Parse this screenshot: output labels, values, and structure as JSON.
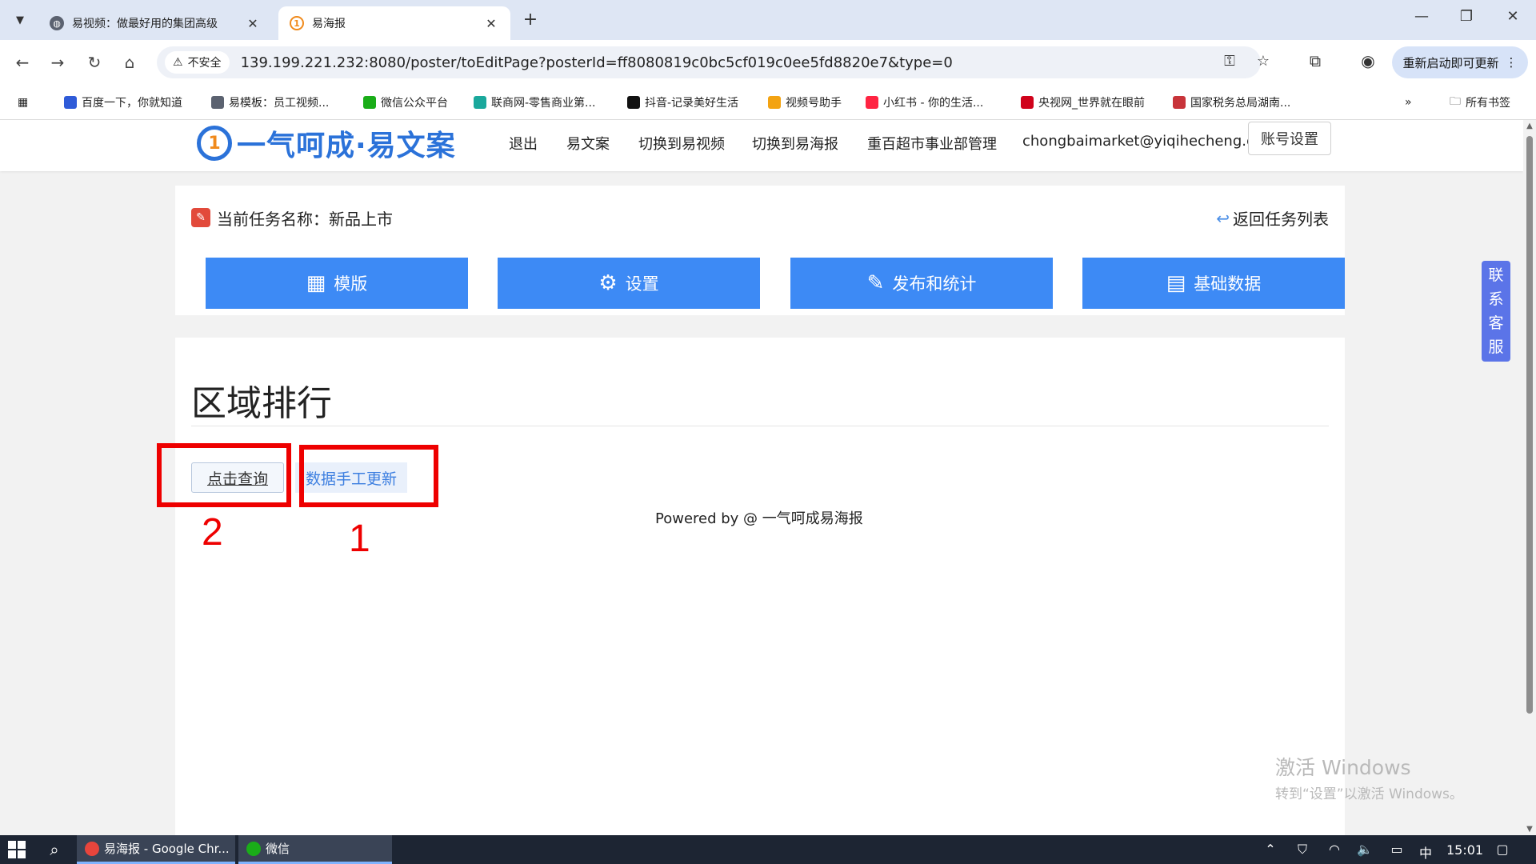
{
  "browser": {
    "tabs": [
      {
        "title": "易视频：做最好用的集团高级"
      },
      {
        "title": "易海报"
      }
    ],
    "new_tab": "+",
    "security_label": "不安全",
    "url": "139.199.221.232:8080/poster/toEditPage?posterId=ff8080819c0bc5cf019c0ee5fd8820e7&type=0",
    "update_button": "重新启动即可更新",
    "bookmarks": [
      {
        "label": "百度一下，你就知道",
        "color": "#2f5bd8"
      },
      {
        "label": "易模板：员工视频...",
        "color": "#5b6270"
      },
      {
        "label": "微信公众平台",
        "color": "#1aad19"
      },
      {
        "label": "联商网-零售商业第...",
        "color": "#1aa89c"
      },
      {
        "label": "抖音-记录美好生活",
        "color": "#111111"
      },
      {
        "label": "视频号助手",
        "color": "#f3a312"
      },
      {
        "label": "小红书 - 你的生活...",
        "color": "#ff2442"
      },
      {
        "label": "央视网_世界就在眼前",
        "color": "#d0021b"
      },
      {
        "label": "国家税务总局湖南...",
        "color": "#c8343a"
      }
    ],
    "all_bookmarks": "所有书签"
  },
  "header": {
    "logo_mark": "1",
    "logo_text": "一气呵成·易文案",
    "nav": [
      "退出",
      "易文案",
      "切换到易视频",
      "切换到易海报",
      "重百超市事业部管理",
      "chongbaimarket@yiqihecheng.cc"
    ],
    "account_button": "账号设置"
  },
  "task": {
    "label": "当前任务名称：新品上市",
    "back_link": "返回任务列表",
    "buttons": [
      {
        "label": "模版",
        "icon": "layout-icon"
      },
      {
        "label": "设置",
        "icon": "gear-icon"
      },
      {
        "label": "发布和统计",
        "icon": "edit-icon"
      },
      {
        "label": "基础数据",
        "icon": "report-icon"
      }
    ]
  },
  "content": {
    "title": "区域排行",
    "query_button": "点击查询",
    "update_button": "数据手工更新",
    "powered_by": "Powered by @ 一气呵成易海报"
  },
  "annotations": [
    {
      "number": "2",
      "target": "点击查询"
    },
    {
      "number": "1",
      "target": "数据手工更新"
    }
  ],
  "service": {
    "chars": [
      "联",
      "系",
      "客",
      "服"
    ]
  },
  "watermark": {
    "line1": "激活 Windows",
    "line2": "转到“设置”以激活 Windows。"
  },
  "taskbar": {
    "apps": [
      {
        "label": "易海报 - Google Chr..."
      },
      {
        "label": "微信"
      }
    ],
    "ime": "中",
    "time": "15:01"
  },
  "colors": {
    "accent": "#3d8af5",
    "logo": "#2b72d9",
    "annotation": "#ee0000",
    "service": "#5b74e8"
  }
}
